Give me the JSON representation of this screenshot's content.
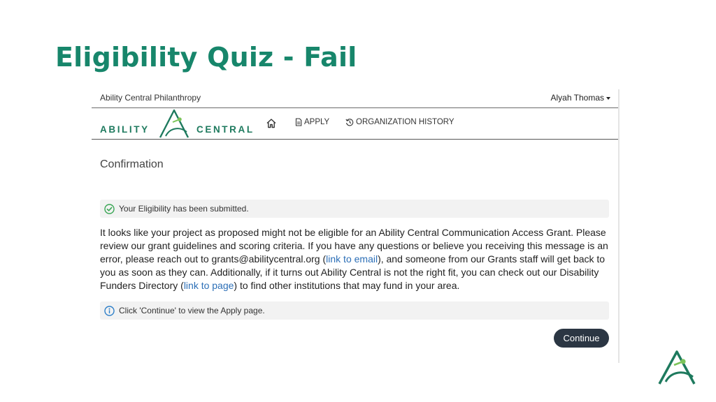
{
  "slide": {
    "title": "Eligibility Quiz - Fail"
  },
  "app": {
    "org_name": "Ability Central Philanthropy",
    "user_name": "Alyah Thomas",
    "logo": {
      "left_word": "ABILITY",
      "right_word": "CENTRAL"
    },
    "nav": {
      "items": [
        {
          "label": "",
          "icon": "home-icon"
        },
        {
          "label": "APPLY",
          "icon": "document-icon"
        },
        {
          "label": "ORGANIZATION HISTORY",
          "icon": "history-icon"
        }
      ]
    }
  },
  "main": {
    "heading": "Confirmation",
    "success_alert": {
      "text": "Your Eligibility has been submitted.",
      "icon": "check-circle-icon"
    },
    "message": {
      "part1": "It looks like your project as proposed might not be eligible for an Ability Central Communication Access Grant. Please review our grant guidelines and scoring criteria. If you have any questions or believe you receiving this message is an error, please reach out to grants@abilitycentral.org (",
      "link_email": "link to email",
      "part2": "), and someone from our Grants staff will get back to you as soon as they can. Additionally, if it turns out Ability Central is not the right fit, you can check out our Disability Funders Directory (",
      "link_page": "link to page",
      "part3": ") to find other institutions that may fund in your area."
    },
    "info_alert": {
      "text": "Click 'Continue' to view the Apply page.",
      "icon": "info-icon"
    },
    "continue_label": "Continue"
  },
  "colors": {
    "title_green": "#17866b",
    "logo_green": "#1e7a5e",
    "logo_accent": "#7cc45a",
    "link_blue": "#2c6fb7",
    "success_green": "#3aa655",
    "info_blue": "#2f80c9",
    "button_dark": "#2b3643"
  }
}
